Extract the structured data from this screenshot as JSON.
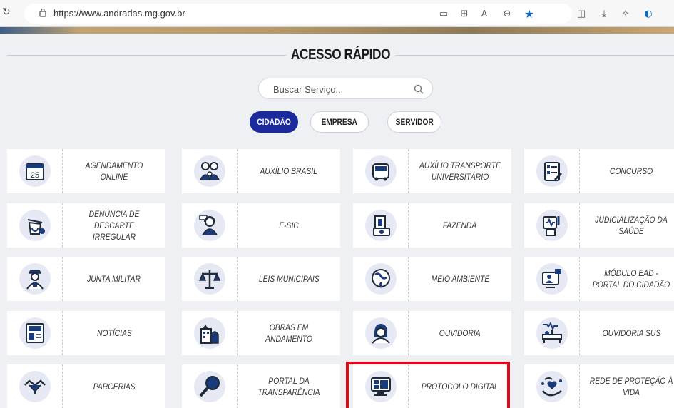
{
  "browser": {
    "url": "https://www.andradas.mg.gov.br"
  },
  "page": {
    "section_title": "ACESSO RÁPIDO",
    "search": {
      "placeholder": "Buscar Serviço..."
    },
    "tabs": [
      {
        "label": "CIDADÃO",
        "active": true
      },
      {
        "label": "EMPRESA",
        "active": false
      },
      {
        "label": "SERVIDOR",
        "active": false
      }
    ],
    "cards": [
      {
        "label": "AGENDAMENTO ONLINE",
        "icon": "calendar-icon"
      },
      {
        "label": "AUXÍLIO BRASIL",
        "icon": "family-icon"
      },
      {
        "label": "AUXÍLIO TRANSPORTE UNIVERSITÁRIO",
        "icon": "bus-icon"
      },
      {
        "label": "CONCURSO",
        "icon": "exam-checklist-icon"
      },
      {
        "label": "DENÚNCIA DE DESCARTE IRREGULAR",
        "icon": "trash-recycle-icon"
      },
      {
        "label": "E-SIC",
        "icon": "support-agent-icon"
      },
      {
        "label": "FAZENDA",
        "icon": "money-documents-icon"
      },
      {
        "label": "JUDICIALIZAÇÃO DA SAÚDE",
        "icon": "health-monitor-icon"
      },
      {
        "label": "JUNTA MILITAR",
        "icon": "soldier-icon"
      },
      {
        "label": "LEIS MUNICIPAIS",
        "icon": "scales-icon"
      },
      {
        "label": "MEIO AMBIENTE",
        "icon": "earth-plant-icon"
      },
      {
        "label": "MÓDULO EAD - PORTAL DO CIDADÃO",
        "icon": "online-class-icon"
      },
      {
        "label": "NOTÍCIAS",
        "icon": "newspaper-icon"
      },
      {
        "label": "OBRAS EM ANDAMENTO",
        "icon": "construction-building-icon"
      },
      {
        "label": "OUVIDORIA",
        "icon": "listener-woman-icon"
      },
      {
        "label": "OUVIDORIA SUS",
        "icon": "hospital-bed-icon"
      },
      {
        "label": "PARCERIAS",
        "icon": "handshake-icon"
      },
      {
        "label": "PORTAL DA TRANSPARÊNCIA",
        "icon": "magnifier-icon"
      },
      {
        "label": "PROTOCOLO DIGITAL",
        "icon": "computer-protocol-icon"
      },
      {
        "label": "REDE DE PROTEÇÃO À VIDA",
        "icon": "heart-hands-icon"
      }
    ]
  },
  "colors": {
    "accent": "#1a2a9c",
    "highlight": "#e30613",
    "icon_dark": "#1f2b3a"
  }
}
